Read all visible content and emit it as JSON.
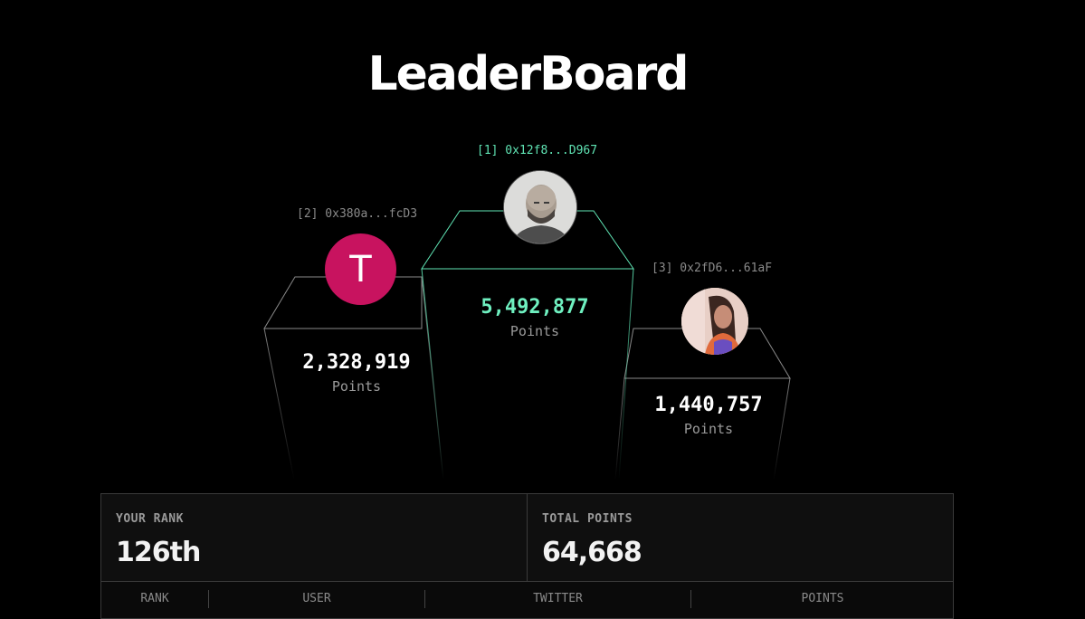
{
  "page": {
    "title": "LeaderBoard"
  },
  "podium": [
    {
      "rank_label": "[2] 0x380a...fcD3",
      "avatar_letter": "T",
      "avatar_color": "#c8135f",
      "points": "2,328,919",
      "points_label": "Points"
    },
    {
      "rank_label": "[1] 0x12f8...D967",
      "avatar_kind": "photo-man",
      "points": "5,492,877",
      "points_label": "Points"
    },
    {
      "rank_label": "[3] 0x2fD6...61aF",
      "avatar_kind": "photo-woman",
      "points": "1,440,757",
      "points_label": "Points"
    }
  ],
  "stats": {
    "your_rank_label": "YOUR RANK",
    "your_rank_value": "126th",
    "total_points_label": "TOTAL POINTS",
    "total_points_value": "64,668"
  },
  "table": {
    "columns": [
      "RANK",
      "USER",
      "TWITTER",
      "POINTS"
    ]
  },
  "colors": {
    "accent": "#6ff0c0",
    "avatar_t": "#c8135f",
    "background": "#000000"
  }
}
